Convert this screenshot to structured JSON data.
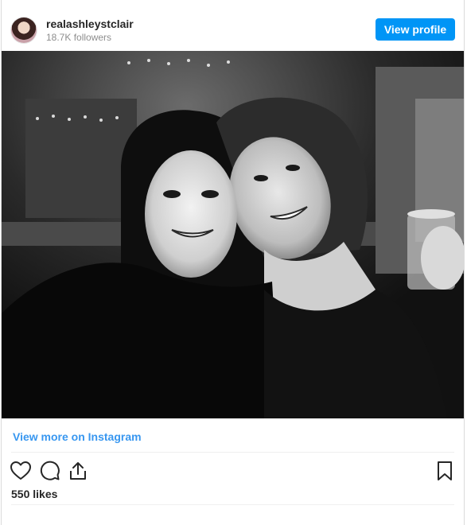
{
  "header": {
    "username": "realashleystclair",
    "followers": "18.7K followers",
    "view_profile_label": "View profile"
  },
  "footer": {
    "view_more_label": "View more on Instagram",
    "likes": "550 likes"
  },
  "icons": {
    "like": "heart-icon",
    "comment": "comment-icon",
    "share": "share-icon",
    "save": "bookmark-icon"
  },
  "colors": {
    "accent": "#0095f6",
    "link": "#3897f0",
    "text": "#262626",
    "muted": "#8e8e8e"
  }
}
